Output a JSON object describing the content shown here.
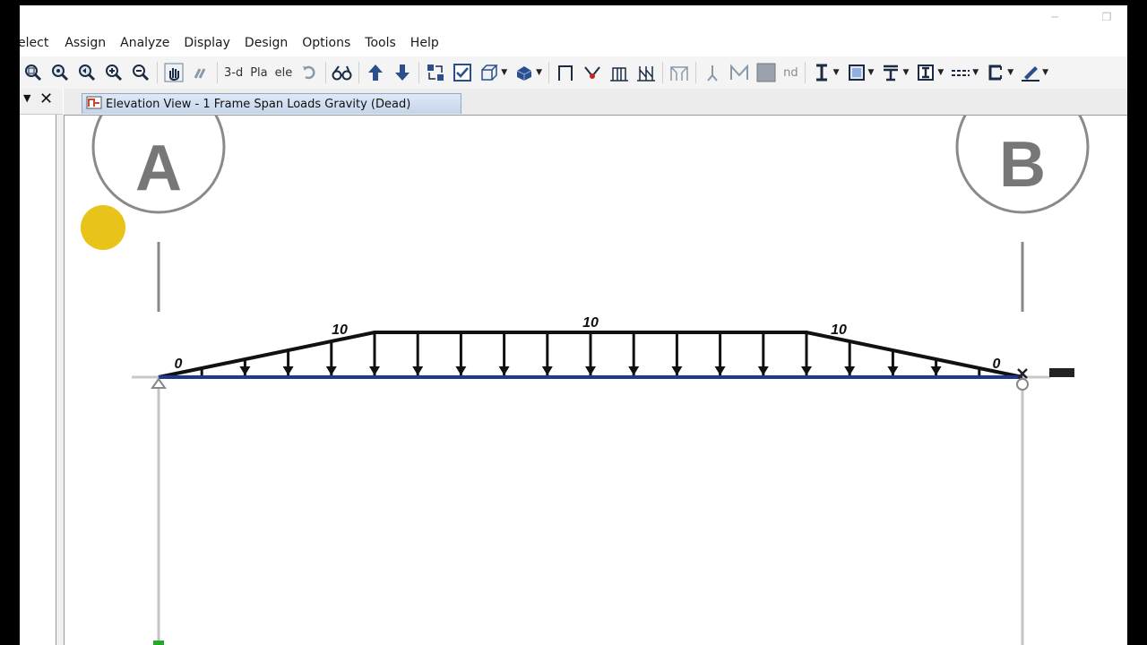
{
  "menu": [
    "elect",
    "Assign",
    "Analyze",
    "Display",
    "Design",
    "Options",
    "Tools",
    "Help"
  ],
  "toolbar": {
    "view_3d": "3-d",
    "plan": "Pla",
    "elev": "ele",
    "nd": "nd"
  },
  "icons": [
    "zoom-rubber-band-icon",
    "zoom-restore-icon",
    "zoom-previous-icon",
    "zoom-in-icon",
    "zoom-out-icon",
    "pan-icon",
    "pointer-icon",
    "rotate-icon",
    "glasses-icon",
    "move-up-icon",
    "move-down-icon",
    "snap-icon",
    "check-icon",
    "object-shrink-icon",
    "extrude-icon",
    "frame-icon",
    "link-icon",
    "column-icon",
    "brace-icon",
    "wall-icon",
    "section-i-icon",
    "section-box-icon",
    "section-t-icon",
    "section-channel-icon",
    "section-dash-icon",
    "section-c-icon",
    "pen-icon"
  ],
  "panel": {
    "menu_glyph": "▼",
    "close_glyph": "✕"
  },
  "tab": {
    "label": "Elevation View - 1  Frame Span Loads Gravity (Dead)"
  },
  "grid": {
    "left": "A",
    "right": "B"
  },
  "loads": {
    "start": "0",
    "ramp_left": "10",
    "mid": "10",
    "ramp_right": "10",
    "end": "0"
  },
  "load_profile": {
    "segments": [
      {
        "from": 0.0,
        "to": 0.25,
        "w_start": 0,
        "w_end": 10
      },
      {
        "from": 0.25,
        "to": 0.75,
        "w_start": 10,
        "w_end": 10
      },
      {
        "from": 0.75,
        "to": 1.0,
        "w_start": 10,
        "w_end": 0
      }
    ]
  },
  "colors": {
    "beam": "#1f3a8a",
    "load": "#111111",
    "grid_bubble": "#888888",
    "cursor_dot": "#e8c41a",
    "support_marker": "#22aa22"
  }
}
